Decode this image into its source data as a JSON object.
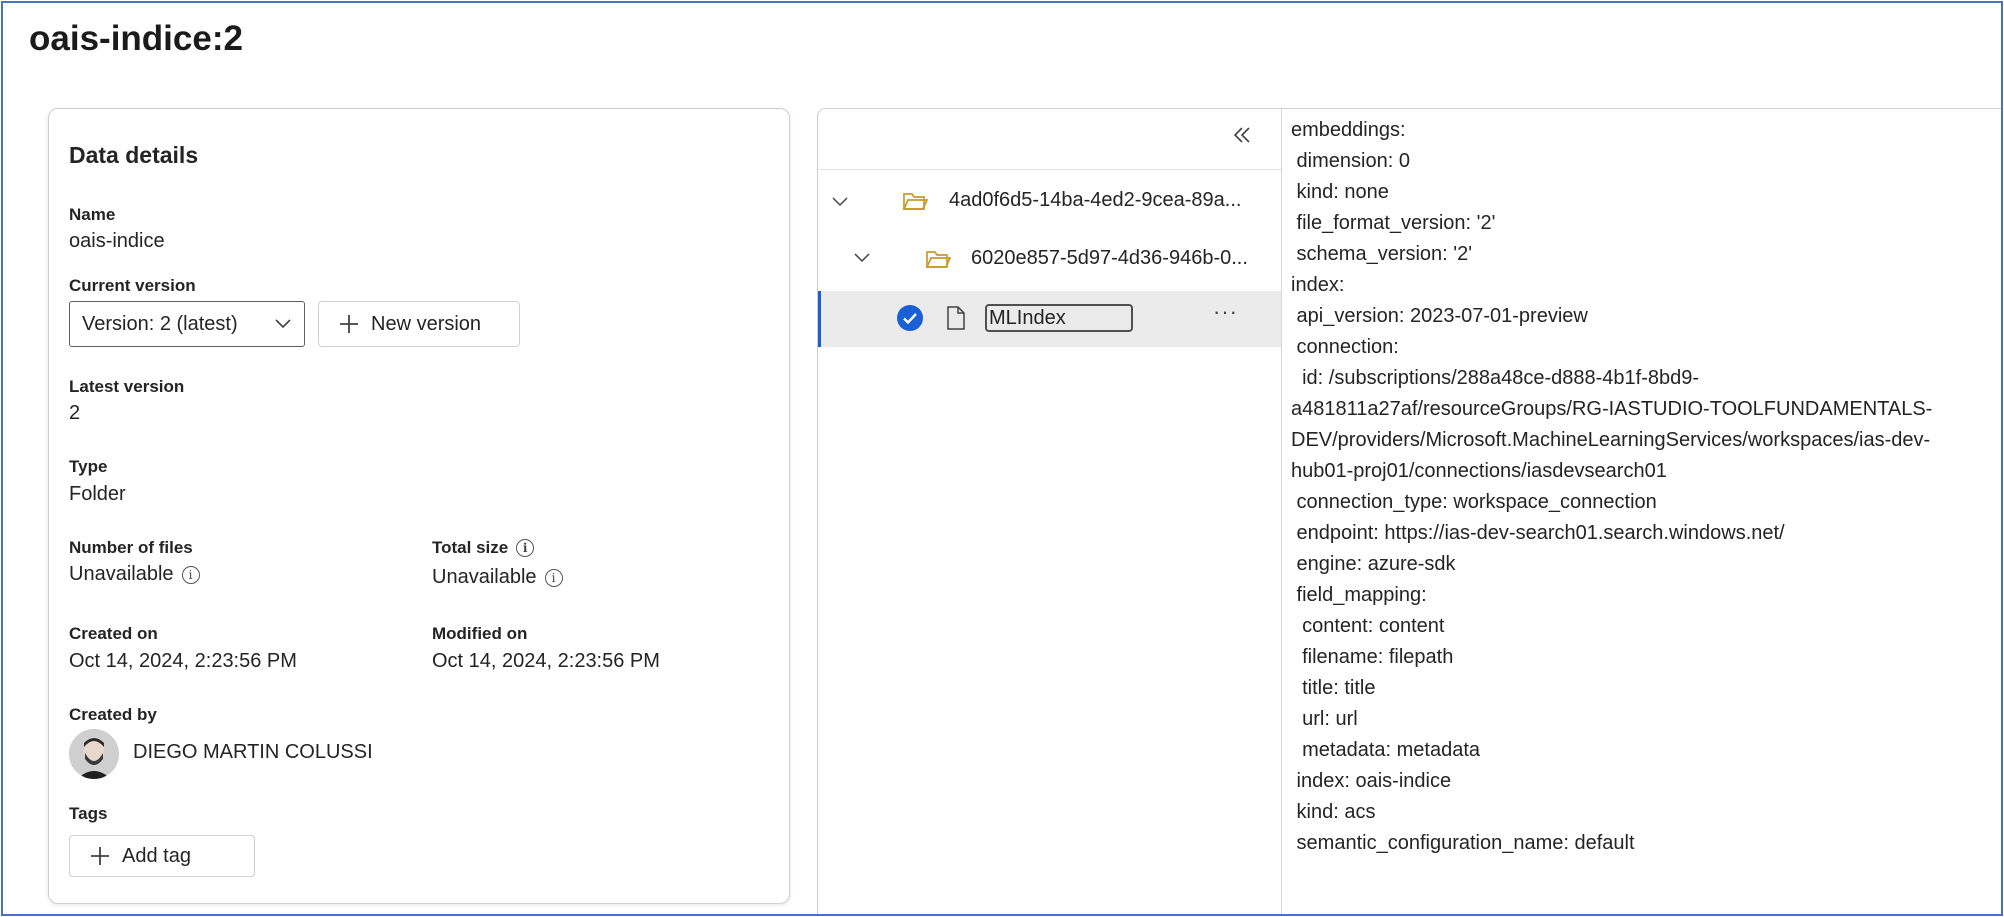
{
  "page": {
    "title": "oais-indice:2"
  },
  "details": {
    "heading": "Data details",
    "name_label": "Name",
    "name_value": "oais-indice",
    "current_version_label": "Current version",
    "current_version_value": "Version: 2 (latest)",
    "new_version_label": "New version",
    "latest_version_label": "Latest version",
    "latest_version_value": "2",
    "type_label": "Type",
    "type_value": "Folder",
    "num_files_label": "Number of files",
    "num_files_value": "Unavailable",
    "total_size_label": "Total size",
    "total_size_value": "Unavailable",
    "created_on_label": "Created on",
    "created_on_value": "Oct 14, 2024, 2:23:56 PM",
    "modified_on_label": "Modified on",
    "modified_on_value": "Oct 14, 2024, 2:23:56 PM",
    "created_by_label": "Created by",
    "created_by_value": "DIEGO MARTIN COLUSSI",
    "tags_label": "Tags",
    "add_tag_label": "Add tag"
  },
  "tree": {
    "items": [
      {
        "name": "4ad0f6d5-14ba-4ed2-9cea-89a...",
        "kind": "folder",
        "expanded": true
      },
      {
        "name": "6020e857-5d97-4d36-946b-0...",
        "kind": "folder",
        "expanded": true
      },
      {
        "name": "MLIndex",
        "kind": "file",
        "selected": true
      }
    ],
    "more_label": "···"
  },
  "content": {
    "lines": [
      "embeddings:",
      " dimension: 0",
      " kind: none",
      " file_format_version: '2'",
      " schema_version: '2'",
      "index:",
      " api_version: 2023-07-01-preview",
      " connection:",
      "  id: /subscriptions/288a48ce-d888-4b1f-8bd9-",
      "a481811a27af/resourceGroups/RG-IASTUDIO-TOOLFUNDAMENTALS-",
      "DEV/providers/Microsoft.MachineLearningServices/workspaces/ias-dev-",
      "hub01-proj01/connections/iasdevsearch01",
      " connection_type: workspace_connection",
      " endpoint: https://ias-dev-search01.search.windows.net/",
      " engine: azure-sdk",
      " field_mapping:",
      "  content: content",
      "  filename: filepath",
      "  title: title",
      "  url: url",
      "  metadata: metadata",
      " index: oais-indice",
      " kind: acs",
      " semantic_configuration_name: default"
    ]
  },
  "colors": {
    "accent": "#1a5fd6",
    "frame": "#4a72c4",
    "folder": "#c79a2a"
  }
}
